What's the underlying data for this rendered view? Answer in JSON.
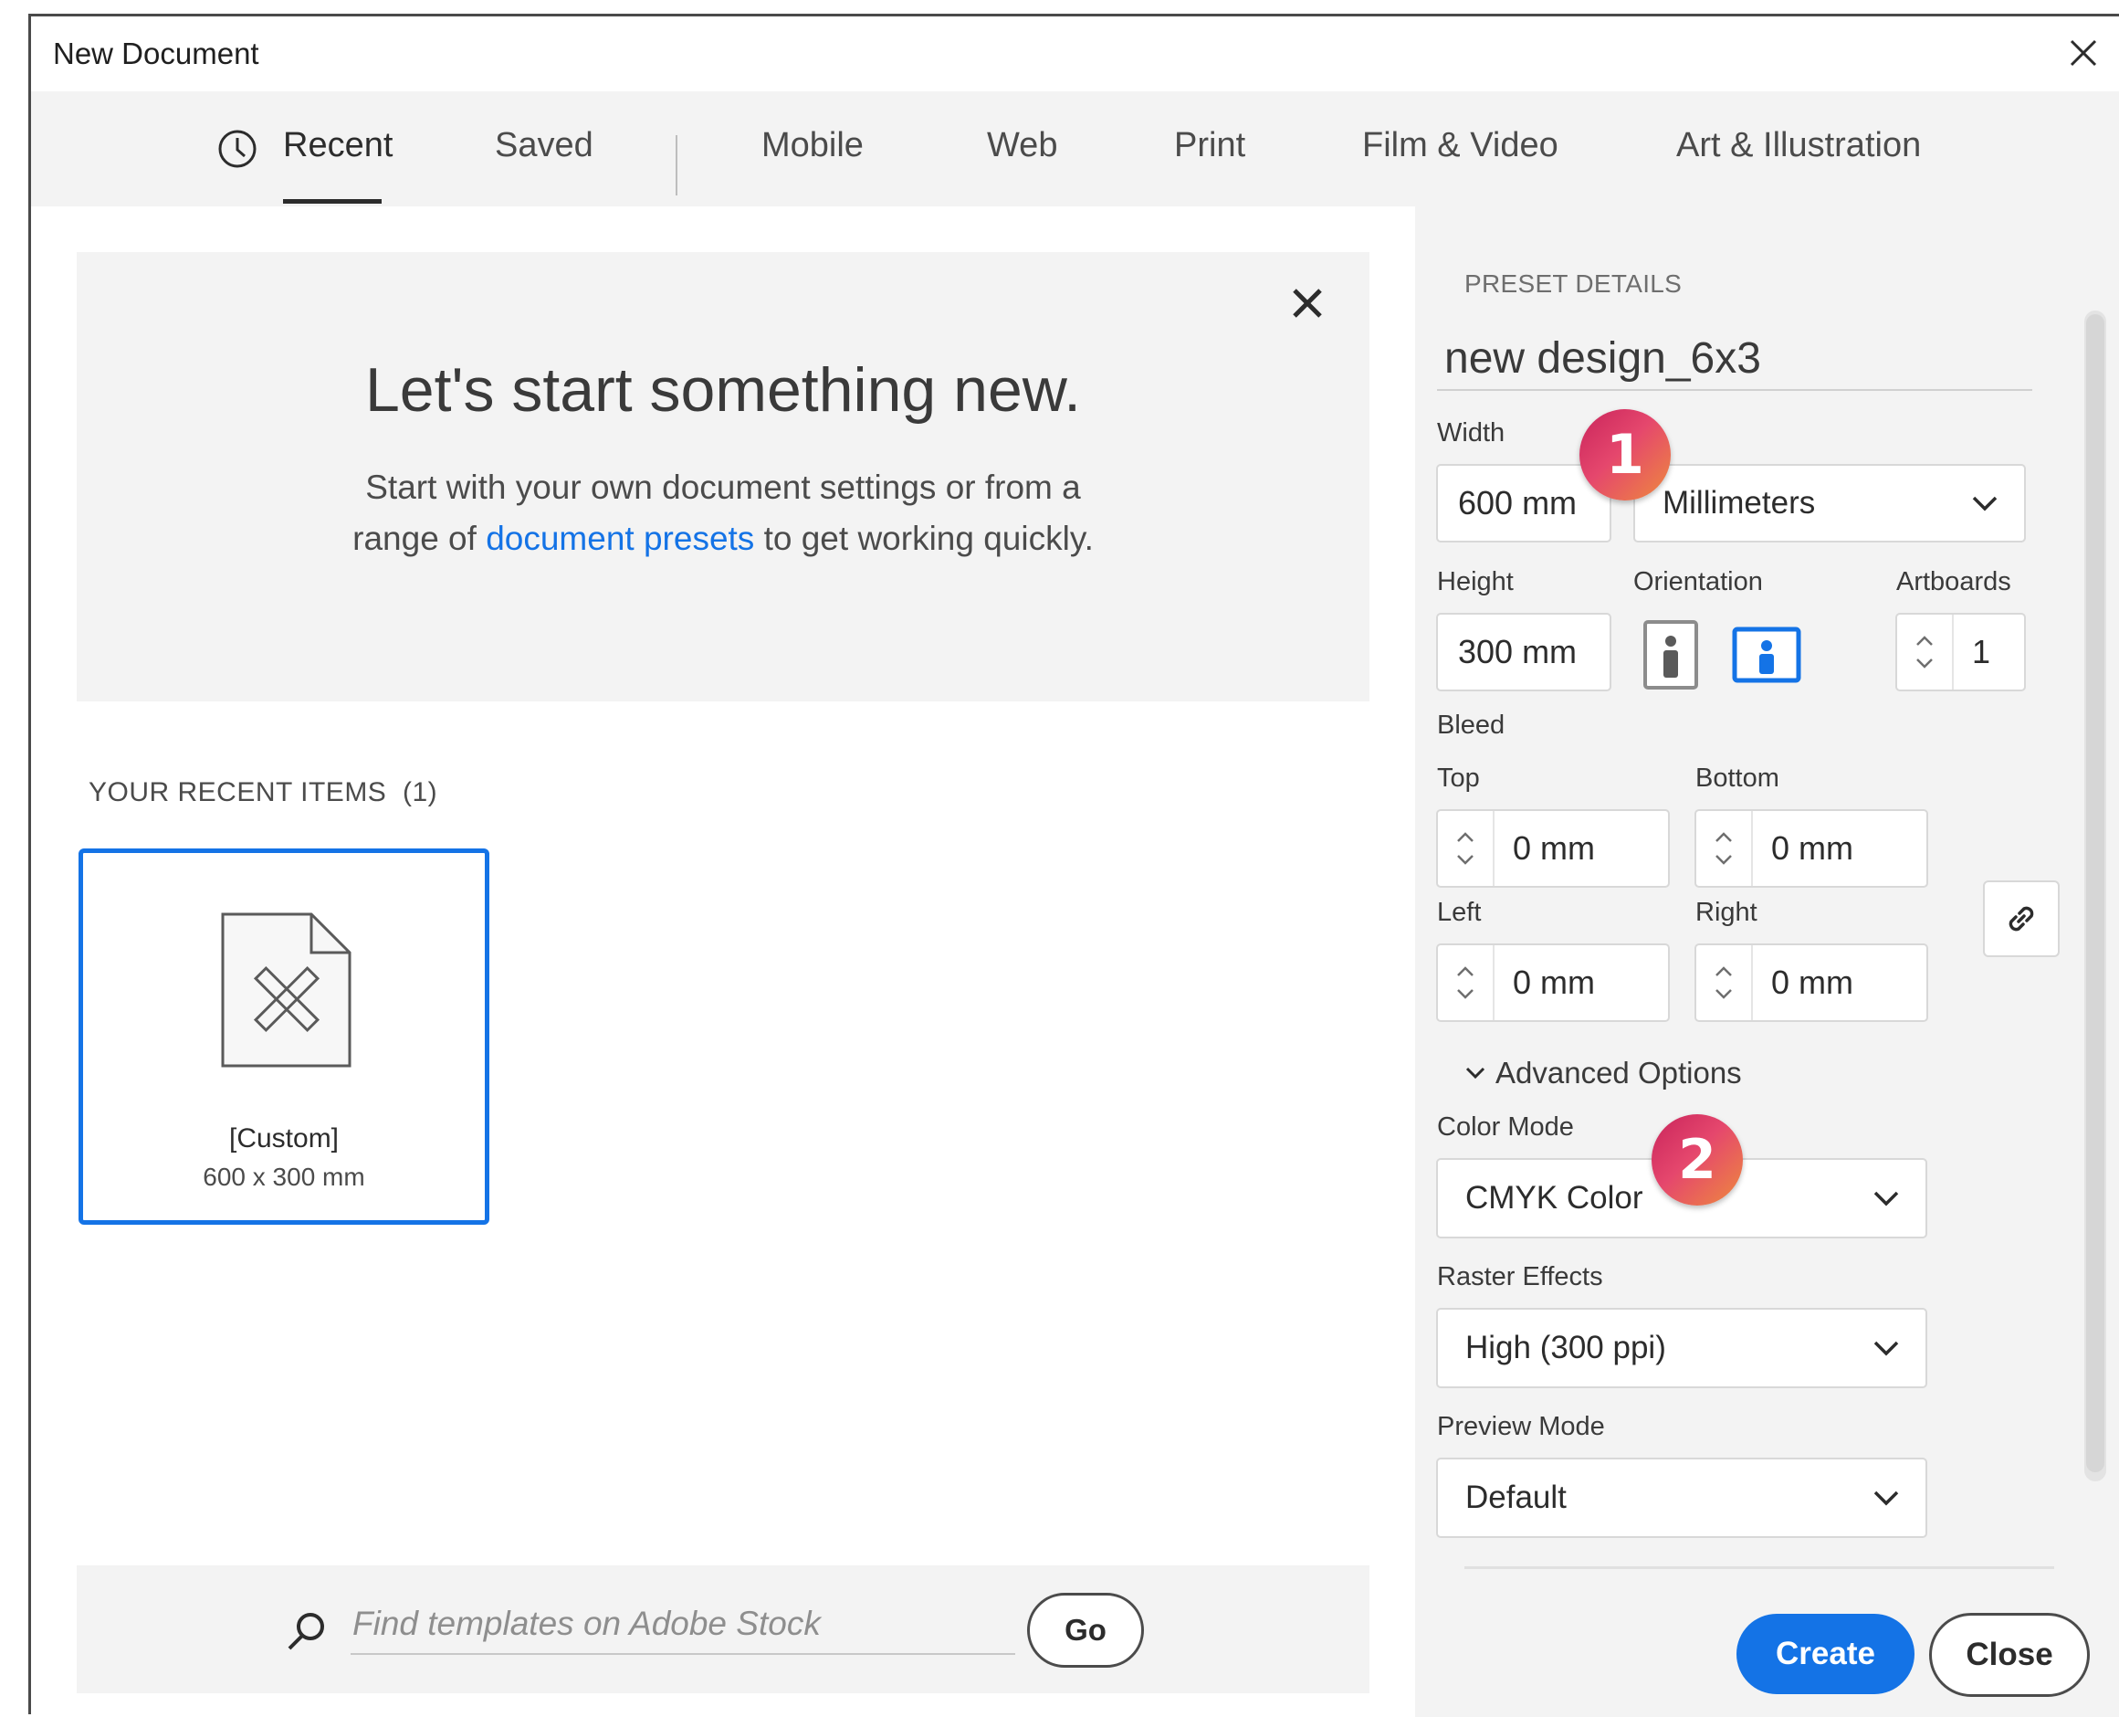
{
  "window": {
    "title": "New Document"
  },
  "tabs": [
    {
      "label": "Recent",
      "active": true
    },
    {
      "label": "Saved"
    },
    {
      "label": "Mobile"
    },
    {
      "label": "Web"
    },
    {
      "label": "Print"
    },
    {
      "label": "Film & Video"
    },
    {
      "label": "Art & Illustration"
    }
  ],
  "hero": {
    "title": "Let's start something new.",
    "text_before": "Start with your own document settings or from a range of ",
    "link": "document presets",
    "text_after": " to get working quickly."
  },
  "recent": {
    "heading": "YOUR RECENT ITEMS",
    "count": "(1)",
    "items": [
      {
        "name": "[Custom]",
        "size": "600 x 300 mm"
      }
    ]
  },
  "search": {
    "placeholder": "Find templates on Adobe Stock",
    "go_label": "Go"
  },
  "preset": {
    "heading": "PRESET DETAILS",
    "name": "new design_6x3",
    "width_label": "Width",
    "width": "600 mm",
    "units": "Millimeters",
    "height_label": "Height",
    "height": "300 mm",
    "orientation_label": "Orientation",
    "orientation_selected": "landscape",
    "artboards_label": "Artboards",
    "artboards": "1",
    "bleed_label": "Bleed",
    "bleed": {
      "top_label": "Top",
      "top": "0 mm",
      "bottom_label": "Bottom",
      "bottom": "0 mm",
      "left_label": "Left",
      "left": "0 mm",
      "right_label": "Right",
      "right": "0 mm"
    },
    "advanced_label": "Advanced Options",
    "color_mode_label": "Color Mode",
    "color_mode": "CMYK Color",
    "raster_label": "Raster Effects",
    "raster": "High (300 ppi)",
    "preview_label": "Preview Mode",
    "preview": "Default"
  },
  "buttons": {
    "create": "Create",
    "close": "Close"
  },
  "badges": [
    "1",
    "2"
  ],
  "colors": {
    "accent": "#1473e6",
    "panel_bg": "#f3f3f3",
    "badge_start": "#c9245b",
    "badge_end": "#ee8a3d"
  }
}
